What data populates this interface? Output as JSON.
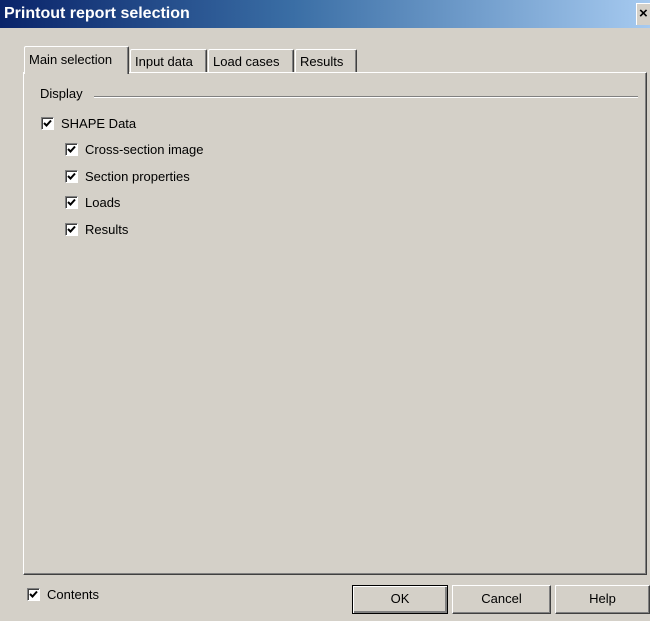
{
  "window": {
    "title": "Printout report selection",
    "close_glyph": "×"
  },
  "tabs": [
    {
      "label": "Main selection",
      "active": true
    },
    {
      "label": "Input data",
      "active": false
    },
    {
      "label": "Load cases",
      "active": false
    },
    {
      "label": "Results",
      "active": false
    }
  ],
  "display_group": {
    "label": "Display",
    "items": [
      {
        "label": "SHAPE Data",
        "checked": true
      },
      {
        "label": "Cross-section image",
        "checked": true
      },
      {
        "label": "Section properties",
        "checked": true
      },
      {
        "label": "Loads",
        "checked": true
      },
      {
        "label": "Results",
        "checked": true
      }
    ]
  },
  "footer": {
    "contents_label": "Contents",
    "contents_checked": true,
    "ok_label": "OK",
    "cancel_label": "Cancel",
    "help_label": "Help"
  },
  "colors": {
    "title_start": "#0a246a",
    "title_end": "#a6caf0",
    "face": "#d4d0c8"
  }
}
